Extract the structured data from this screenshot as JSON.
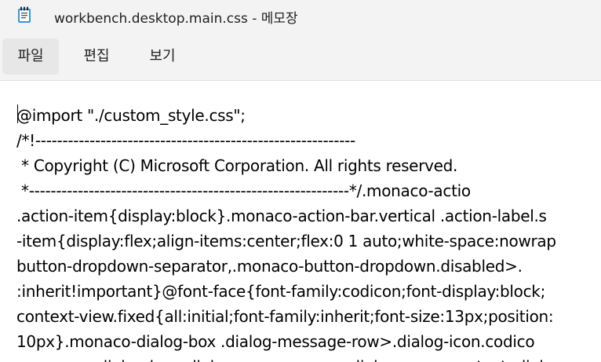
{
  "window": {
    "title": "workbench.desktop.main.css - 메모장"
  },
  "icons": {
    "app": "notepad-icon"
  },
  "menu": {
    "items": [
      {
        "label": "파일"
      },
      {
        "label": "편집"
      },
      {
        "label": "보기"
      }
    ]
  },
  "editor": {
    "lines": [
      "@import \"./custom_style.css\";",
      "/*!-----------------------------------------------------------",
      " * Copyright (C) Microsoft Corporation. All rights reserved.",
      " *-----------------------------------------------------------*/.monaco-actio",
      ".action-item{display:block}.monaco-action-bar.vertical .action-label.s",
      "-item{display:flex;align-items:center;flex:0 1 auto;white-space:nowrap",
      "button-dropdown-separator,.monaco-button-dropdown.disabled>.",
      ":inherit!important}@font-face{font-family:codicon;font-display:block;",
      "context-view.fixed{all:initial;font-family:inherit;font-size:13px;position:",
      "10px}.monaco-dialog-box .dialog-message-row>.dialog-icon.codico",
      "...monaco-dialog-box .dialog-message-row .dialog-message-text .dialog-"
    ]
  }
}
